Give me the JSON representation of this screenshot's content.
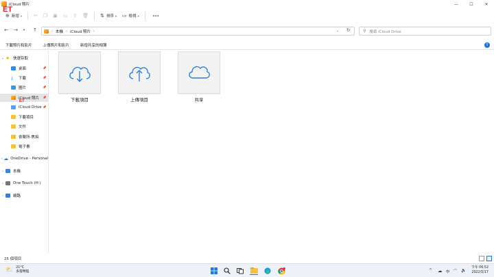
{
  "window": {
    "title": "iCloud 照片",
    "controls": {
      "minimize": "—",
      "maximize": "☐",
      "close": "✕"
    }
  },
  "watermark": {
    "text": "ET"
  },
  "commandbar": {
    "new_label": "新增",
    "sort_label": "排序",
    "view_label": "檢視",
    "more_label": "···"
  },
  "address": {
    "root_label": "本機",
    "folder_label": "iCloud 照片",
    "search_placeholder": "搜尋 iCloud Drive"
  },
  "banner": {
    "links": [
      "下載照片和影片",
      "上傳照片和影片",
      "新增共享的相簿"
    ],
    "info": "!"
  },
  "sidebar": {
    "quick_access": "快速存取",
    "items": [
      {
        "label": "桌面",
        "icon": "desktop-icon"
      },
      {
        "label": "下載",
        "icon": "download-icon"
      },
      {
        "label": "圖片",
        "icon": "pictures-icon"
      },
      {
        "label": "iCloud 照片",
        "icon": "icloud-photos-icon"
      },
      {
        "label": "iCloud Drive",
        "icon": "icloud-drive-icon"
      },
      {
        "label": "下載項目",
        "icon": "folder-icon"
      },
      {
        "label": "文件",
        "icon": "folder-icon"
      },
      {
        "label": "會聚所-焦焰",
        "icon": "folder-icon"
      },
      {
        "label": "電子書",
        "icon": "folder-icon"
      }
    ],
    "onedrive": "OneDrive - Personal",
    "this_pc": "本機",
    "drive": "One Touch (H:)",
    "network": "網路"
  },
  "tiles": [
    {
      "label": "下載項目",
      "icon": "cloud-download-icon"
    },
    {
      "label": "上傳項目",
      "icon": "cloud-upload-icon"
    },
    {
      "label": "共享",
      "icon": "cloud-icon"
    }
  ],
  "status": {
    "count": "25 個項目"
  },
  "taskbar": {
    "weather_temp": "21°C",
    "weather_desc": "多雲時陰",
    "time": "下午 06:52",
    "date": "2022/5/17",
    "ime": "中",
    "tray_chevron": "^"
  },
  "colors": {
    "accent": "#1976d2",
    "cloud": "#2b7fd6",
    "folder": "#f5c23e",
    "watermark": "#d8262c"
  }
}
